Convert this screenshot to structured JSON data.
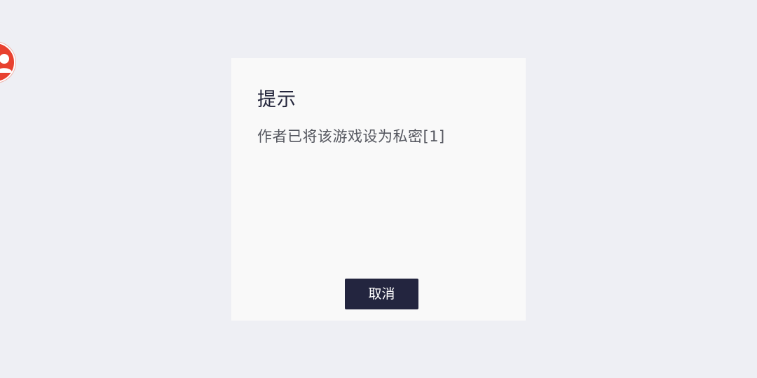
{
  "side_widget": {
    "icon": "user-avatar-icon",
    "color": "#e8412f"
  },
  "dialog": {
    "title": "提示",
    "message": "作者已将该游戏设为私密[1]",
    "cancel_label": "取消",
    "button_color": "#23253f",
    "background_color": "#f9f9f9"
  },
  "page": {
    "background_color": "#eeeff4"
  }
}
